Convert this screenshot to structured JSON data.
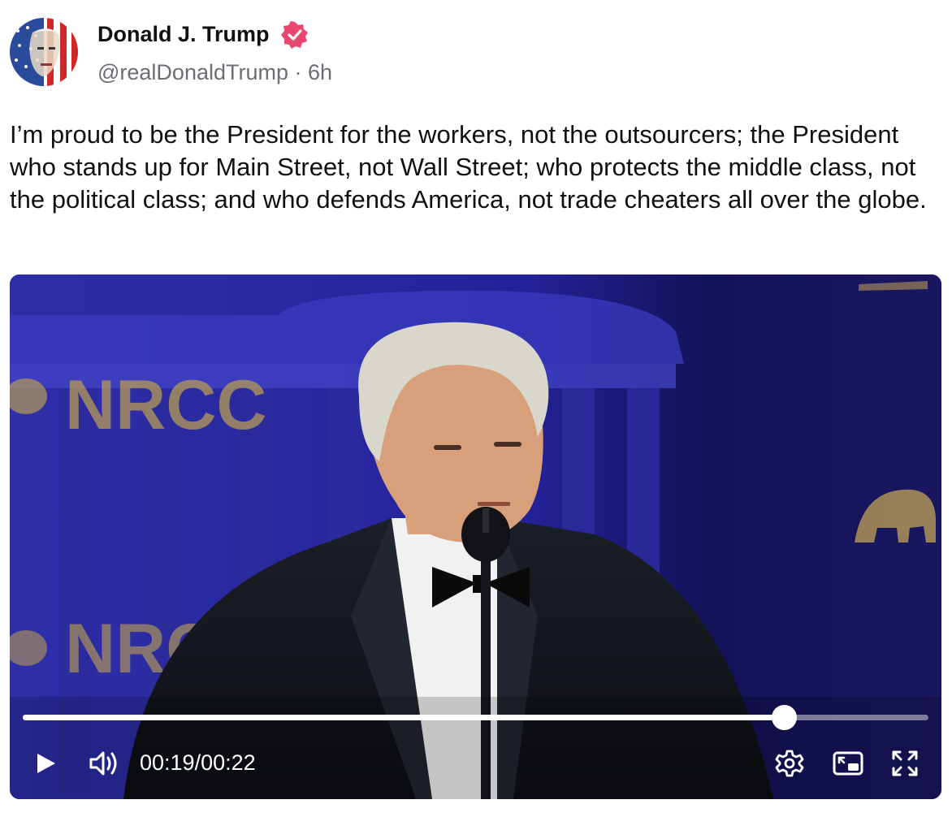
{
  "author": {
    "name": "Donald J. Trump",
    "handle": "@realDonaldTrump",
    "separator": "·",
    "time_ago": "6h",
    "verified_icon": "verified-badge-icon"
  },
  "post": {
    "text": "I’m proud to be the President for the workers, not the outsourcers; the President who stands up for Main Street, not Wall Street; who protects the middle class, not the political class; and who defends America, not trade cheaters all over the globe."
  },
  "video": {
    "background_text_1": "NRCC",
    "background_text_2": "NRCC",
    "current_time": "00:19",
    "time_separator": "/",
    "duration": "00:22",
    "progress": 0.84,
    "icons": {
      "play": "play-icon",
      "volume": "volume-icon",
      "settings": "gear-icon",
      "pip": "picture-in-picture-icon",
      "fullscreen": "fullscreen-icon"
    }
  },
  "colors": {
    "verified": "#e8476f",
    "handle": "#6b6e74",
    "video_bg": "#1c1a6e"
  }
}
